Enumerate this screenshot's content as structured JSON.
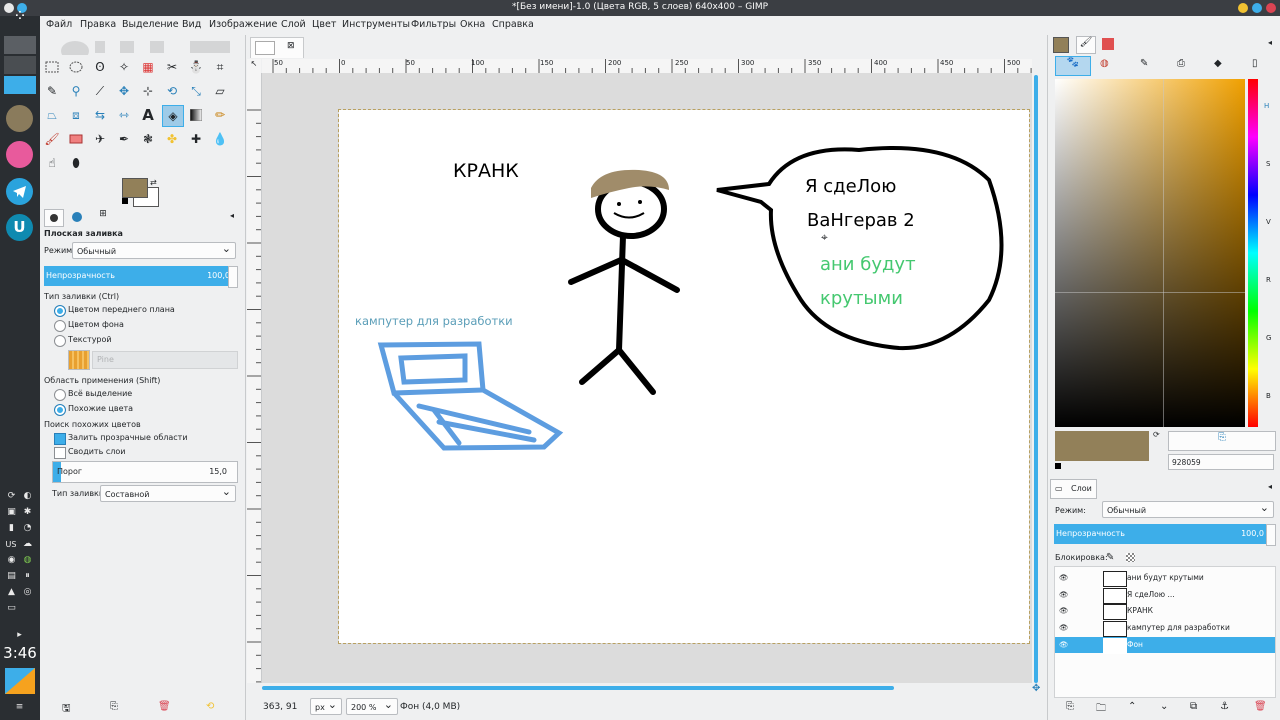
{
  "window": {
    "title": "*[Без имени]-1.0 (Цвета RGB, 5 слоев) 640x400 – GIMP"
  },
  "taskbar": {
    "clock": "3:46",
    "keyboard_layout": "US"
  },
  "menubar": {
    "items": [
      "Файл",
      "Правка",
      "Выделение",
      "Вид",
      "Изображение",
      "Слой",
      "Цвет",
      "Инструменты",
      "Фильтры",
      "Окна",
      "Справка"
    ]
  },
  "tool_options": {
    "title": "Плоская заливка",
    "mode_label": "Режим:",
    "mode_value": "Обычный",
    "opacity_label": "Непрозрачность",
    "opacity_value": "100,0",
    "fill_type_label": "Тип заливки (Ctrl)",
    "fill_options": [
      "Цветом переднего плана",
      "Цветом фона",
      "Текстурой"
    ],
    "pattern_name": "Pine",
    "area_label": "Область применения (Shift)",
    "area_options": [
      "Всё выделение",
      "Похожие цвета"
    ],
    "similar_label": "Поиск похожих цветов",
    "fill_transparent": "Залить прозрачные области",
    "sample_merged": "Сводить слои",
    "threshold_label": "Порог",
    "threshold_value": "15,0",
    "fill_kind_label": "Тип заливки:",
    "fill_kind_value": "Составной"
  },
  "canvas": {
    "ruler_marks": [
      "50",
      "0",
      "50",
      "100",
      "150",
      "200",
      "250",
      "300",
      "350",
      "400",
      "450",
      "500"
    ],
    "drawing_texts": {
      "krank": "КРАНК",
      "computer": "кампутер для разработки",
      "bubble_line1": "Я сдеЛою",
      "bubble_line2": "ВаНгерав 2",
      "bubble_line3": "ани будут",
      "bubble_line4": "крутыми"
    }
  },
  "statusbar": {
    "coords": "363, 91",
    "unit": "px",
    "zoom": "200 %",
    "layer_info": "Фон (4,0 MB)"
  },
  "colors": {
    "foreground": "#928059",
    "hex_value": "928059",
    "accent": "#3daee9"
  },
  "layers_panel": {
    "tab": "Слои",
    "mode_label": "Режим:",
    "mode_value": "Обычный",
    "opacity_label": "Непрозрачность",
    "opacity_value": "100,0",
    "lock_label": "Блокировка:",
    "layers": [
      {
        "name": "ани будут крутыми",
        "selected": false
      },
      {
        "name": "Я сдеЛою ...",
        "selected": false
      },
      {
        "name": "КРАНК",
        "selected": false
      },
      {
        "name": "кампутер для разработки",
        "selected": false
      },
      {
        "name": "Фон",
        "selected": true
      }
    ]
  }
}
